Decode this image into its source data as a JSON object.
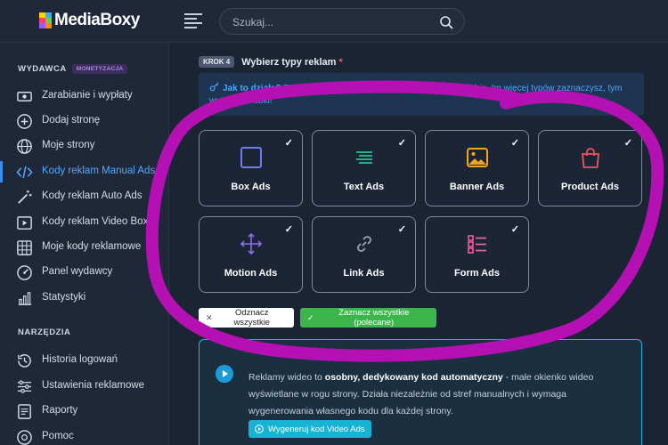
{
  "app": {
    "logo_text": "MediaBoxy"
  },
  "search": {
    "placeholder": "Szukaj..."
  },
  "sidebar": {
    "section_publisher": "WYDAWCA",
    "section_badge": "MONETYZACJA",
    "items": [
      {
        "label": "Zarabianie i wypłaty",
        "icon": "cash-icon"
      },
      {
        "label": "Dodaj stronę",
        "icon": "plus-circle-icon"
      },
      {
        "label": "Moje strony",
        "icon": "globe-icon"
      },
      {
        "label": "Kody reklam Manual Ads",
        "icon": "code-icon",
        "active": true
      },
      {
        "label": "Kody reklam Auto Ads",
        "icon": "magic-wand-icon"
      },
      {
        "label": "Kody reklam Video Box",
        "icon": "video-play-icon"
      },
      {
        "label": "Moje kody reklamowe",
        "icon": "grid-icon"
      },
      {
        "label": "Panel wydawcy",
        "icon": "gauge-icon"
      },
      {
        "label": "Statystyki",
        "icon": "bar-chart-icon"
      }
    ],
    "section_tools": "NARZĘDZIA",
    "tools": [
      {
        "label": "Historia logowań",
        "icon": "history-icon"
      },
      {
        "label": "Ustawienia reklamowe",
        "icon": "sliders-icon"
      },
      {
        "label": "Raporty",
        "icon": "report-icon"
      },
      {
        "label": "Pomoc",
        "icon": "help-icon"
      }
    ]
  },
  "step": {
    "badge": "KROK 4",
    "title": "Wybierz typy reklam",
    "required_mark": "*"
  },
  "info": {
    "lead": "Jak to działa?",
    "text": "Reklamy są wyświetlane w wybranych przez Ciebie. Im więcej typów zaznaczysz, tym wyższe zarobki!"
  },
  "ad_types": [
    {
      "label": "Box Ads",
      "icon": "square-outline-icon",
      "checked": true
    },
    {
      "label": "Text Ads",
      "icon": "text-lines-icon",
      "checked": true
    },
    {
      "label": "Banner Ads",
      "icon": "image-icon",
      "checked": true
    },
    {
      "label": "Product Ads",
      "icon": "shopping-bag-icon",
      "checked": true
    },
    {
      "label": "Motion Ads",
      "icon": "move-arrows-icon",
      "checked": true
    },
    {
      "label": "Link Ads",
      "icon": "link-icon",
      "checked": true
    },
    {
      "label": "Form Ads",
      "icon": "form-list-icon",
      "checked": true
    }
  ],
  "check_mark": "✓",
  "buttons": {
    "deselect_all": "Odznacz wszystkie",
    "select_all": "Zaznacz wszystkie (polecane)",
    "generate_video": "Wygeneruj kod Video Ads"
  },
  "video": {
    "text_1": "Reklamy wideo to ",
    "text_bold": "osobny, dedykowany kod automatyczny",
    "text_2": " - małe okienko wideo wyświetlane w rogu strony. Działa niezależnie od stref manualnych i wymaga wygenerowania własnego kodu dla każdej strony."
  },
  "colors": {
    "accent": "#3d8ef0",
    "annotation": "#b410b4",
    "green": "#3cb64a",
    "cyan": "#18b3d3"
  }
}
